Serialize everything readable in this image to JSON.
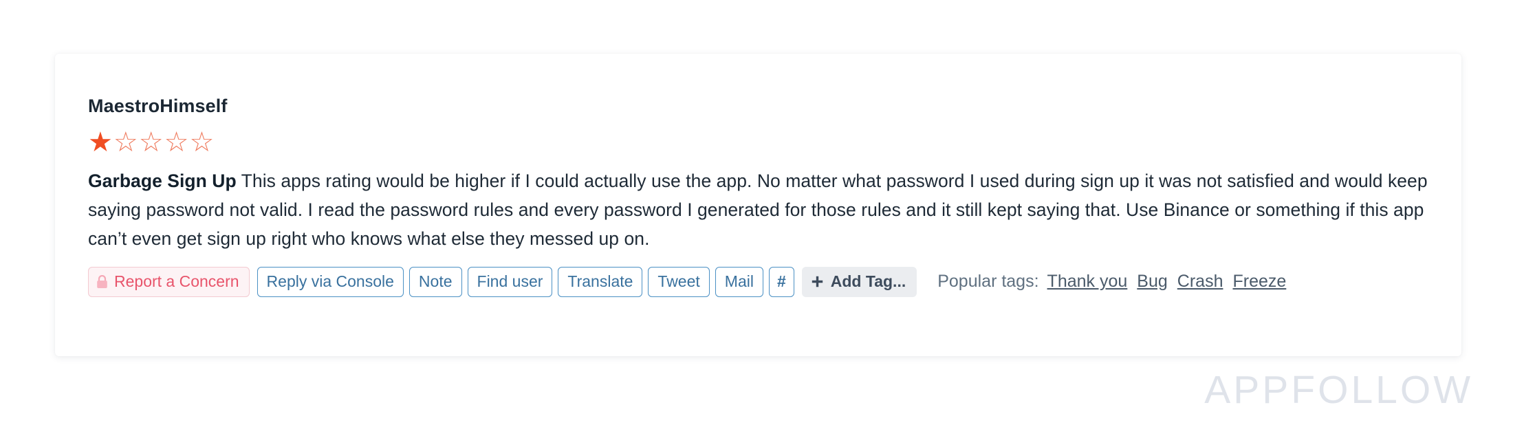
{
  "review": {
    "author": "MaestroHimself",
    "rating": 1,
    "rating_max": 5,
    "title": "Garbage Sign Up",
    "body": " This apps rating would be higher if I could actually use the app. No matter what password I used during sign up it was not satisfied and would keep saying password not valid. I read the password rules and every password I generated for those rules and it still kept saying that. Use Binance or something if this app can’t even get sign up right who knows what else they messed up on."
  },
  "actions": {
    "report": "Report a Concern",
    "reply": "Reply via Console",
    "note": "Note",
    "find_user": "Find user",
    "translate": "Translate",
    "tweet": "Tweet",
    "mail": "Mail",
    "hash": "#",
    "add_tag": "Add Tag..."
  },
  "popular_tags": {
    "label": "Popular tags:",
    "tags": [
      "Thank you",
      "Bug",
      "Crash",
      "Freeze"
    ]
  },
  "watermark": "APPFOLLOW",
  "icons": {
    "lock": "lock-icon",
    "plus": "plus-icon",
    "star_filled": "★",
    "star_empty": "☆"
  },
  "colors": {
    "star_filled": "#f04e23",
    "star_empty": "#ef7b5e",
    "button_blue": "#4a90c4",
    "danger": "#e8546b",
    "watermark": "#dfe3ea"
  }
}
